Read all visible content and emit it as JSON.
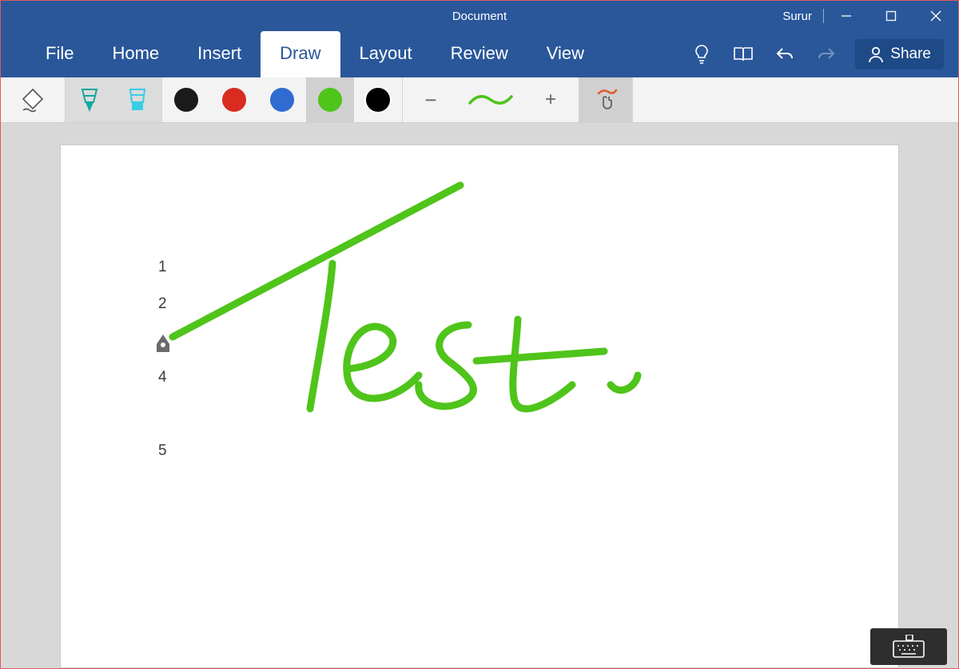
{
  "window": {
    "title": "Document",
    "user": "Surur"
  },
  "tabs": {
    "items": [
      {
        "label": "File",
        "active": false
      },
      {
        "label": "Home",
        "active": false
      },
      {
        "label": "Insert",
        "active": false
      },
      {
        "label": "Draw",
        "active": true
      },
      {
        "label": "Layout",
        "active": false
      },
      {
        "label": "Review",
        "active": false
      },
      {
        "label": "View",
        "active": false
      }
    ],
    "share_label": "Share"
  },
  "colors": {
    "accent": "#2a579a",
    "accent_dark": "#1e4a87",
    "toolbar_bg": "#f3f3f3",
    "canvas_bg": "#d8d8d8",
    "ink": "#4fc41a",
    "pen_teal": "#0fa9a0",
    "highlighter_cyan": "#38cde6"
  },
  "draw_toolbar": {
    "tools": [
      {
        "id": "eraser",
        "name": "eraser-tool",
        "pressed": false
      },
      {
        "id": "pen",
        "name": "pen-tool",
        "pressed": true
      },
      {
        "id": "highlighter",
        "name": "highlighter-tool",
        "pressed": true
      }
    ],
    "swatches": [
      {
        "id": "black",
        "color": "#1a1a1a",
        "selected": false
      },
      {
        "id": "red",
        "color": "#d92b1f",
        "selected": false
      },
      {
        "id": "blue",
        "color": "#2f6bd0",
        "selected": false
      },
      {
        "id": "green",
        "color": "#4fc41a",
        "selected": true
      },
      {
        "id": "more",
        "rainbow": true,
        "selected": false
      }
    ],
    "stroke_controls": {
      "minus": "−",
      "plus": "+"
    },
    "touch_draw": {
      "selected": true
    }
  },
  "document": {
    "list_items": [
      "1",
      "2",
      "",
      "4",
      "",
      "5"
    ],
    "handwriting_text": "Test"
  }
}
